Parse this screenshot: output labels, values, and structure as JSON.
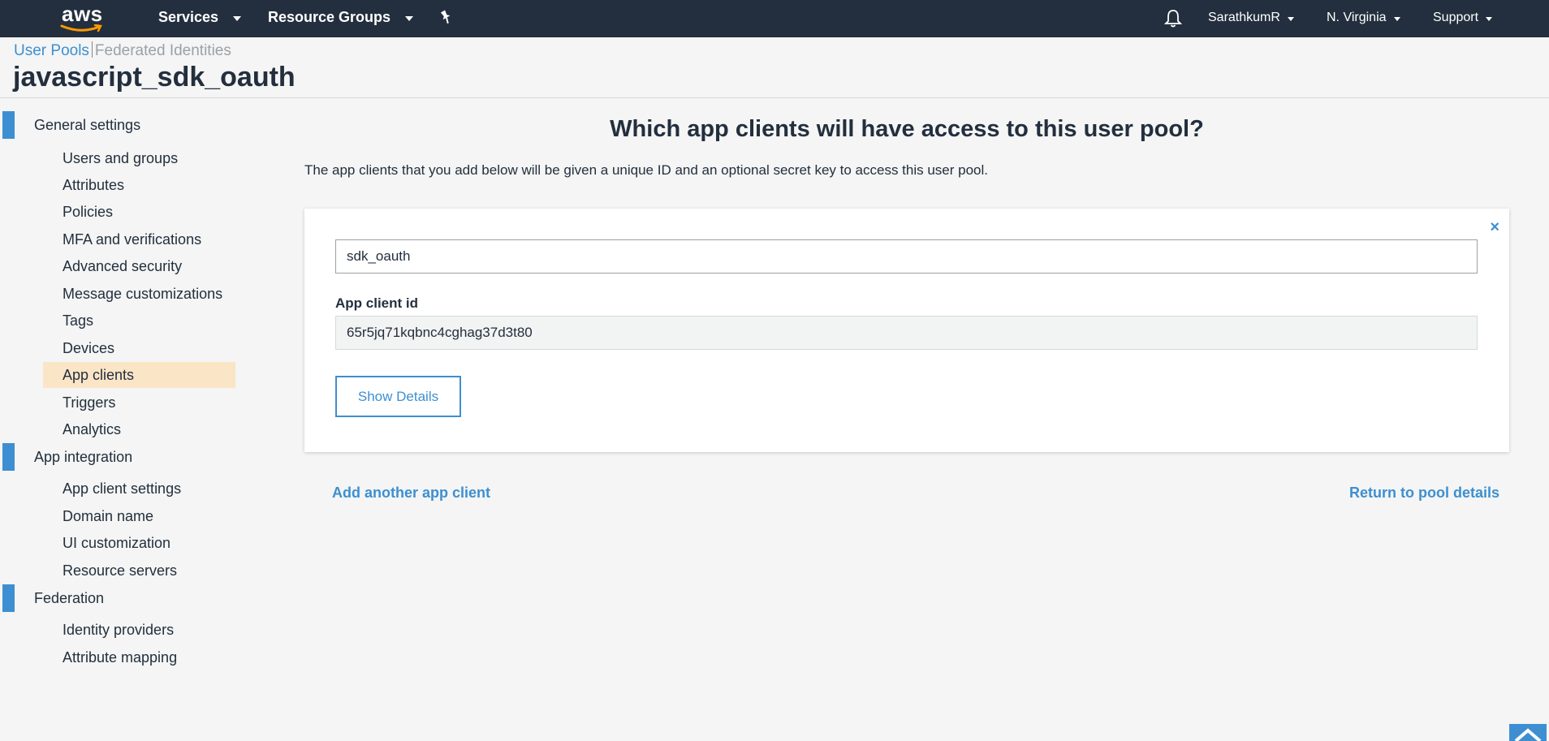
{
  "nav": {
    "logo": "aws",
    "services": "Services",
    "resource_groups": "Resource Groups",
    "user": "SarathkumR",
    "region": "N. Virginia",
    "support": "Support"
  },
  "breadcrumb": {
    "user_pools": "User Pools",
    "federated": "Federated Identities"
  },
  "pool_name": "javascript_sdk_oauth",
  "sidebar": {
    "groups": [
      {
        "label": "General settings",
        "items": [
          "Users and groups",
          "Attributes",
          "Policies",
          "MFA and verifications",
          "Advanced security",
          "Message customizations",
          "Tags",
          "Devices",
          "App clients",
          "Triggers",
          "Analytics"
        ]
      },
      {
        "label": "App integration",
        "items": [
          "App client settings",
          "Domain name",
          "UI customization",
          "Resource servers"
        ]
      },
      {
        "label": "Federation",
        "items": [
          "Identity providers",
          "Attribute mapping"
        ]
      }
    ],
    "active_item": "App clients"
  },
  "main": {
    "title": "Which app clients will have access to this user pool?",
    "description": "The app clients that you add below will be given a unique ID and an optional secret key to access this user pool.",
    "client": {
      "name_value": "sdk_oauth",
      "id_label": "App client id",
      "id_value": "65r5jq71kqbnc4cghag37d3t80",
      "show_details": "Show Details"
    },
    "add_another": "Add another app client",
    "return_link": "Return to pool details"
  },
  "icons": {
    "close": "×",
    "bell": "bell-icon",
    "pin": "pin-icon"
  },
  "colors": {
    "nav_bg": "#232f3e",
    "accent": "#3d8fd1",
    "active_item": "#fbe5c7"
  }
}
